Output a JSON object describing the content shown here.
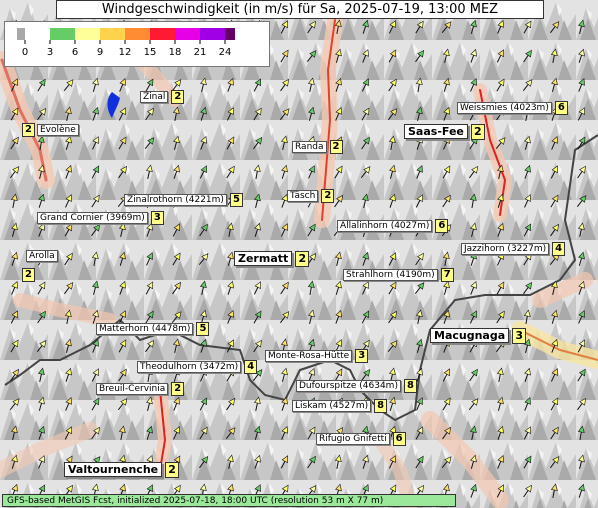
{
  "title": "Windgeschwindigkeit (in m/s) für Sa, 2025-07-19, 13:00 MEZ",
  "footer": "GFS-based MetGIS Fcst, initialized 2025-07-18, 18:00 UTC  (resolution 53 m X 77 m)",
  "legend": {
    "ticks": [
      "0",
      "3",
      "6",
      "9",
      "12",
      "15",
      "18",
      "21",
      "24"
    ],
    "colors": [
      "#a8a8a8",
      "#66cc66",
      "#ffff99",
      "#ffd24d",
      "#ff8c33",
      "#ff1a33",
      "#e600e6",
      "#a000e6",
      "#660066"
    ]
  },
  "places": [
    {
      "name": "Zinal",
      "value": "2",
      "big": false
    },
    {
      "name": "Evolène",
      "value": "2",
      "big": false
    },
    {
      "name": "Weissmies (4023m)",
      "value": "6",
      "big": false
    },
    {
      "name": "Saas-Fee",
      "value": "2",
      "big": true
    },
    {
      "name": "Randa",
      "value": "2",
      "big": false
    },
    {
      "name": "Zinalrothorn (4221m)",
      "value": "5",
      "big": false
    },
    {
      "name": "Täsch",
      "value": "2",
      "big": false
    },
    {
      "name": "Grand Cornier (3969m)",
      "value": "3",
      "big": false
    },
    {
      "name": "Allalinhorn (4027m)",
      "value": "6",
      "big": false
    },
    {
      "name": "Arolla",
      "value": "2",
      "big": false
    },
    {
      "name": "Jazzihorn (3227m)",
      "value": "4",
      "big": false
    },
    {
      "name": "Zermatt",
      "value": "2",
      "big": true
    },
    {
      "name": "Strahlhorn (4190m)",
      "value": "7",
      "big": false
    },
    {
      "name": "Matterhorn (4478m)",
      "value": "5",
      "big": false
    },
    {
      "name": "Macugnaga",
      "value": "3",
      "big": true
    },
    {
      "name": "Monte-Rosa-Hütte",
      "value": "3",
      "big": false
    },
    {
      "name": "Theodulhorn (3472m)",
      "value": "4",
      "big": false
    },
    {
      "name": "Breuil-Cervinia",
      "value": "2",
      "big": false
    },
    {
      "name": "Dufourspitze (4634m)",
      "value": "8",
      "big": false
    },
    {
      "name": "Liskam (4527m)",
      "value": "8",
      "big": false
    },
    {
      "name": "Rifugio Gnifetti",
      "value": "6",
      "big": false
    },
    {
      "name": "Valtournenche",
      "value": "2",
      "big": true
    }
  ]
}
